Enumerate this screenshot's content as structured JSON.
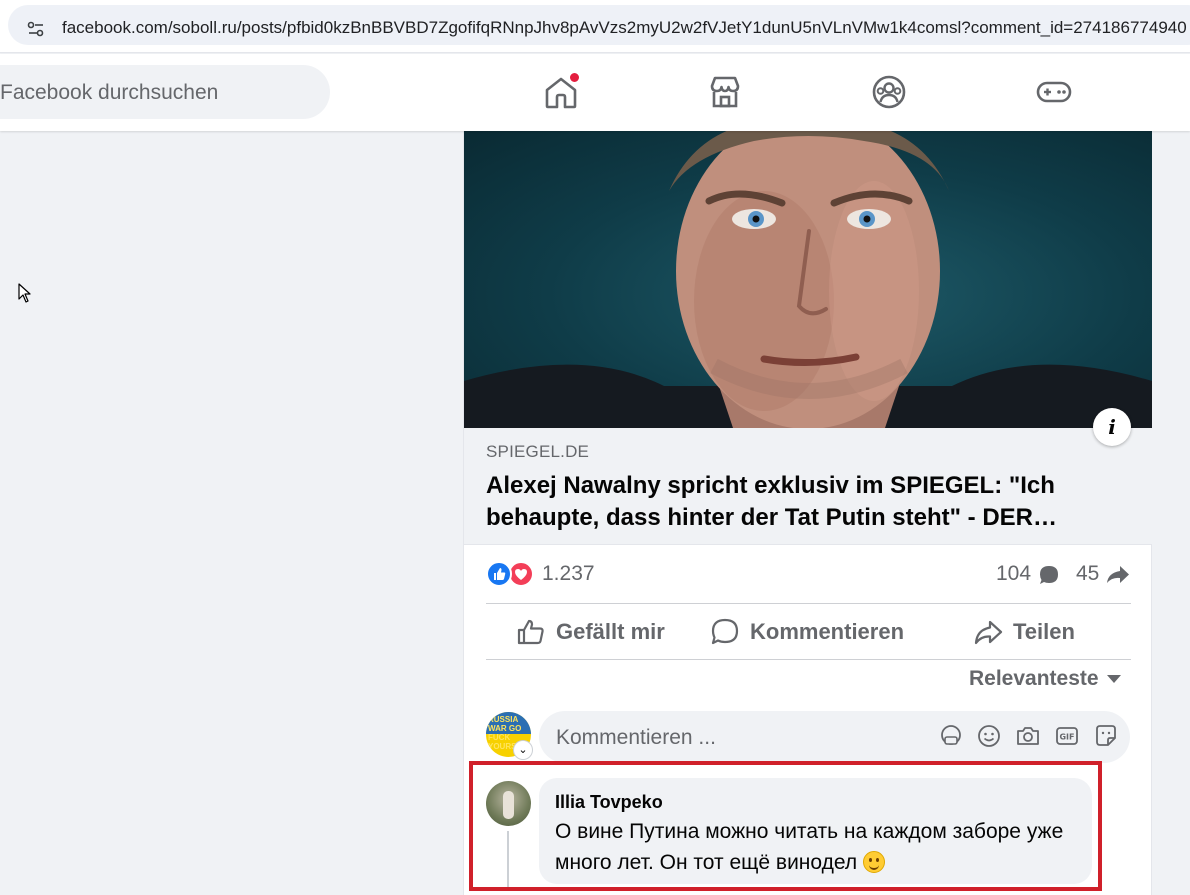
{
  "browser": {
    "url": "facebook.com/soboll.ru/posts/pfbid0kzBnBBVBD7ZgofifqRNnpJhv8pAvVzs2myU2w2fVJetY1dunU5nVLnVMw1k4comsl?comment_id=274186774940"
  },
  "header": {
    "search_placeholder": "Facebook durchsuchen",
    "nav": [
      "home-icon",
      "marketplace-icon",
      "groups-icon",
      "gaming-icon"
    ]
  },
  "post": {
    "link": {
      "domain": "SPIEGEL.DE",
      "headline": "Alexej Nawalny spricht exklusiv im SPIEGEL: \"Ich behaupte, dass hinter der Tat Putin steht\" - DER…",
      "info_label": "i"
    },
    "stats": {
      "reactions": "1.237",
      "comments": "104",
      "shares": "45"
    },
    "actions": {
      "like": "Gefällt mir",
      "comment": "Kommentieren",
      "share": "Teilen"
    },
    "sort_label": "Relevanteste",
    "comment_input_placeholder": "Kommentieren ...",
    "my_avatar_text": "RUSSIA WAR GO FUCK YOURS",
    "comment": {
      "author": "Illia Tovpeko",
      "text": "О вине Путина можно читать на каждом заборе уже много лет. Он тот ещё винодел"
    }
  },
  "colors": {
    "accent": "#1877f2",
    "highlight": "#d0202a",
    "notification": "#e41e3f"
  }
}
